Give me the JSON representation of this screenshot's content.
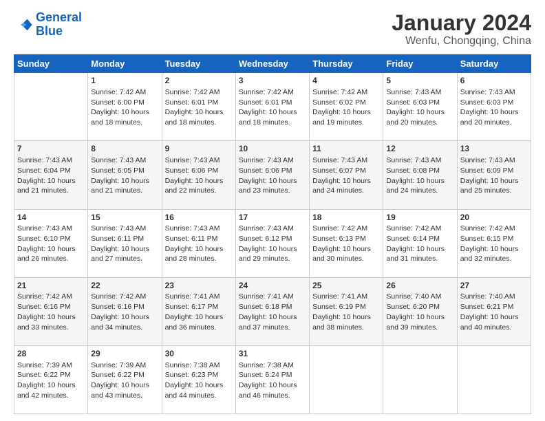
{
  "logo": {
    "line1": "General",
    "line2": "Blue"
  },
  "title": "January 2024",
  "subtitle": "Wenfu, Chongqing, China",
  "weekdays": [
    "Sunday",
    "Monday",
    "Tuesday",
    "Wednesday",
    "Thursday",
    "Friday",
    "Saturday"
  ],
  "weeks": [
    [
      {
        "day": "",
        "sunrise": "",
        "sunset": "",
        "daylight": ""
      },
      {
        "day": "1",
        "sunrise": "Sunrise: 7:42 AM",
        "sunset": "Sunset: 6:00 PM",
        "daylight": "Daylight: 10 hours and 18 minutes."
      },
      {
        "day": "2",
        "sunrise": "Sunrise: 7:42 AM",
        "sunset": "Sunset: 6:01 PM",
        "daylight": "Daylight: 10 hours and 18 minutes."
      },
      {
        "day": "3",
        "sunrise": "Sunrise: 7:42 AM",
        "sunset": "Sunset: 6:01 PM",
        "daylight": "Daylight: 10 hours and 18 minutes."
      },
      {
        "day": "4",
        "sunrise": "Sunrise: 7:42 AM",
        "sunset": "Sunset: 6:02 PM",
        "daylight": "Daylight: 10 hours and 19 minutes."
      },
      {
        "day": "5",
        "sunrise": "Sunrise: 7:43 AM",
        "sunset": "Sunset: 6:03 PM",
        "daylight": "Daylight: 10 hours and 20 minutes."
      },
      {
        "day": "6",
        "sunrise": "Sunrise: 7:43 AM",
        "sunset": "Sunset: 6:03 PM",
        "daylight": "Daylight: 10 hours and 20 minutes."
      }
    ],
    [
      {
        "day": "7",
        "sunrise": "Sunrise: 7:43 AM",
        "sunset": "Sunset: 6:04 PM",
        "daylight": "Daylight: 10 hours and 21 minutes."
      },
      {
        "day": "8",
        "sunrise": "Sunrise: 7:43 AM",
        "sunset": "Sunset: 6:05 PM",
        "daylight": "Daylight: 10 hours and 21 minutes."
      },
      {
        "day": "9",
        "sunrise": "Sunrise: 7:43 AM",
        "sunset": "Sunset: 6:06 PM",
        "daylight": "Daylight: 10 hours and 22 minutes."
      },
      {
        "day": "10",
        "sunrise": "Sunrise: 7:43 AM",
        "sunset": "Sunset: 6:06 PM",
        "daylight": "Daylight: 10 hours and 23 minutes."
      },
      {
        "day": "11",
        "sunrise": "Sunrise: 7:43 AM",
        "sunset": "Sunset: 6:07 PM",
        "daylight": "Daylight: 10 hours and 24 minutes."
      },
      {
        "day": "12",
        "sunrise": "Sunrise: 7:43 AM",
        "sunset": "Sunset: 6:08 PM",
        "daylight": "Daylight: 10 hours and 24 minutes."
      },
      {
        "day": "13",
        "sunrise": "Sunrise: 7:43 AM",
        "sunset": "Sunset: 6:09 PM",
        "daylight": "Daylight: 10 hours and 25 minutes."
      }
    ],
    [
      {
        "day": "14",
        "sunrise": "Sunrise: 7:43 AM",
        "sunset": "Sunset: 6:10 PM",
        "daylight": "Daylight: 10 hours and 26 minutes."
      },
      {
        "day": "15",
        "sunrise": "Sunrise: 7:43 AM",
        "sunset": "Sunset: 6:11 PM",
        "daylight": "Daylight: 10 hours and 27 minutes."
      },
      {
        "day": "16",
        "sunrise": "Sunrise: 7:43 AM",
        "sunset": "Sunset: 6:11 PM",
        "daylight": "Daylight: 10 hours and 28 minutes."
      },
      {
        "day": "17",
        "sunrise": "Sunrise: 7:43 AM",
        "sunset": "Sunset: 6:12 PM",
        "daylight": "Daylight: 10 hours and 29 minutes."
      },
      {
        "day": "18",
        "sunrise": "Sunrise: 7:42 AM",
        "sunset": "Sunset: 6:13 PM",
        "daylight": "Daylight: 10 hours and 30 minutes."
      },
      {
        "day": "19",
        "sunrise": "Sunrise: 7:42 AM",
        "sunset": "Sunset: 6:14 PM",
        "daylight": "Daylight: 10 hours and 31 minutes."
      },
      {
        "day": "20",
        "sunrise": "Sunrise: 7:42 AM",
        "sunset": "Sunset: 6:15 PM",
        "daylight": "Daylight: 10 hours and 32 minutes."
      }
    ],
    [
      {
        "day": "21",
        "sunrise": "Sunrise: 7:42 AM",
        "sunset": "Sunset: 6:16 PM",
        "daylight": "Daylight: 10 hours and 33 minutes."
      },
      {
        "day": "22",
        "sunrise": "Sunrise: 7:42 AM",
        "sunset": "Sunset: 6:16 PM",
        "daylight": "Daylight: 10 hours and 34 minutes."
      },
      {
        "day": "23",
        "sunrise": "Sunrise: 7:41 AM",
        "sunset": "Sunset: 6:17 PM",
        "daylight": "Daylight: 10 hours and 36 minutes."
      },
      {
        "day": "24",
        "sunrise": "Sunrise: 7:41 AM",
        "sunset": "Sunset: 6:18 PM",
        "daylight": "Daylight: 10 hours and 37 minutes."
      },
      {
        "day": "25",
        "sunrise": "Sunrise: 7:41 AM",
        "sunset": "Sunset: 6:19 PM",
        "daylight": "Daylight: 10 hours and 38 minutes."
      },
      {
        "day": "26",
        "sunrise": "Sunrise: 7:40 AM",
        "sunset": "Sunset: 6:20 PM",
        "daylight": "Daylight: 10 hours and 39 minutes."
      },
      {
        "day": "27",
        "sunrise": "Sunrise: 7:40 AM",
        "sunset": "Sunset: 6:21 PM",
        "daylight": "Daylight: 10 hours and 40 minutes."
      }
    ],
    [
      {
        "day": "28",
        "sunrise": "Sunrise: 7:39 AM",
        "sunset": "Sunset: 6:22 PM",
        "daylight": "Daylight: 10 hours and 42 minutes."
      },
      {
        "day": "29",
        "sunrise": "Sunrise: 7:39 AM",
        "sunset": "Sunset: 6:22 PM",
        "daylight": "Daylight: 10 hours and 43 minutes."
      },
      {
        "day": "30",
        "sunrise": "Sunrise: 7:38 AM",
        "sunset": "Sunset: 6:23 PM",
        "daylight": "Daylight: 10 hours and 44 minutes."
      },
      {
        "day": "31",
        "sunrise": "Sunrise: 7:38 AM",
        "sunset": "Sunset: 6:24 PM",
        "daylight": "Daylight: 10 hours and 46 minutes."
      },
      {
        "day": "",
        "sunrise": "",
        "sunset": "",
        "daylight": ""
      },
      {
        "day": "",
        "sunrise": "",
        "sunset": "",
        "daylight": ""
      },
      {
        "day": "",
        "sunrise": "",
        "sunset": "",
        "daylight": ""
      }
    ]
  ]
}
